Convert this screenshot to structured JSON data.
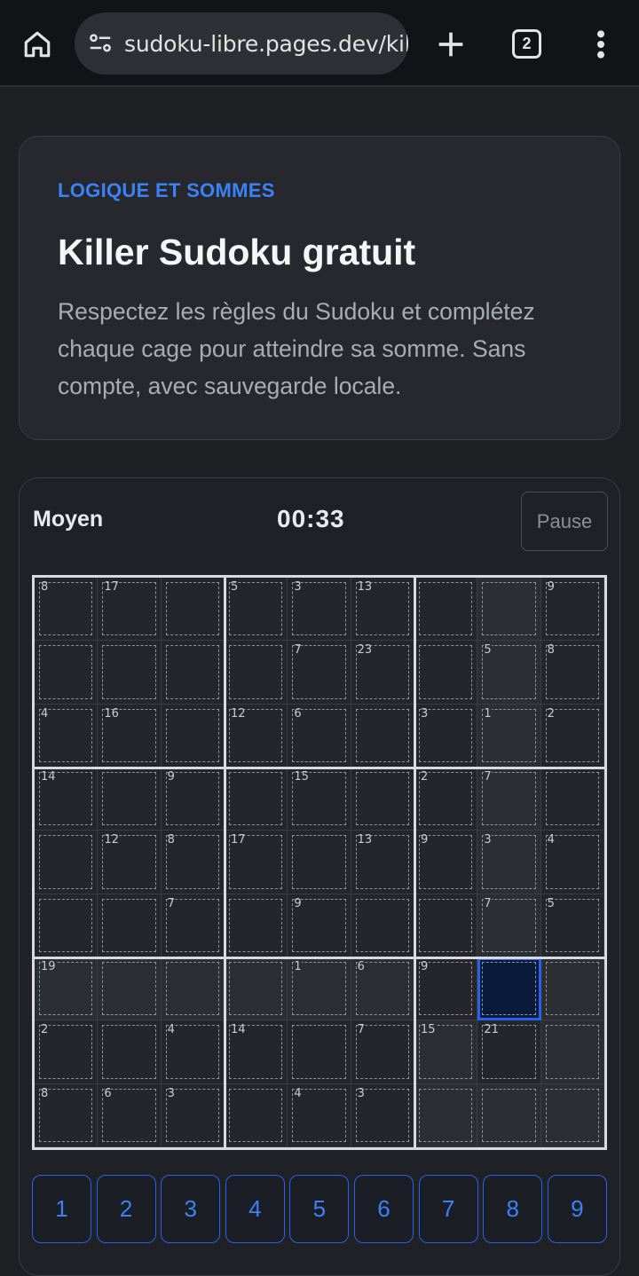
{
  "browser": {
    "url": "sudoku-libre.pages.dev/killer",
    "tab_count": "2"
  },
  "intro": {
    "eyebrow": "LOGIQUE ET SOMMES",
    "title": "Killer Sudoku gratuit",
    "description": "Respectez les règles du Sudoku et complétez chaque cage pour atteindre sa somme. Sans compte, avec sauvegarde locale."
  },
  "game": {
    "difficulty": "Moyen",
    "timer": "00:33",
    "pause_label": "Pause"
  },
  "board": {
    "clues": [
      {
        "r": 0,
        "c": 0,
        "v": "8"
      },
      {
        "r": 0,
        "c": 1,
        "v": "17"
      },
      {
        "r": 0,
        "c": 3,
        "v": "5"
      },
      {
        "r": 0,
        "c": 4,
        "v": "3"
      },
      {
        "r": 0,
        "c": 5,
        "v": "13"
      },
      {
        "r": 0,
        "c": 8,
        "v": "9"
      },
      {
        "r": 1,
        "c": 4,
        "v": "7"
      },
      {
        "r": 1,
        "c": 5,
        "v": "23"
      },
      {
        "r": 1,
        "c": 7,
        "v": "5"
      },
      {
        "r": 1,
        "c": 8,
        "v": "8"
      },
      {
        "r": 2,
        "c": 0,
        "v": "4"
      },
      {
        "r": 2,
        "c": 1,
        "v": "16"
      },
      {
        "r": 2,
        "c": 3,
        "v": "12"
      },
      {
        "r": 2,
        "c": 4,
        "v": "6"
      },
      {
        "r": 2,
        "c": 6,
        "v": "3"
      },
      {
        "r": 2,
        "c": 7,
        "v": "1"
      },
      {
        "r": 2,
        "c": 8,
        "v": "2"
      },
      {
        "r": 3,
        "c": 0,
        "v": "14"
      },
      {
        "r": 3,
        "c": 2,
        "v": "9"
      },
      {
        "r": 3,
        "c": 4,
        "v": "15"
      },
      {
        "r": 3,
        "c": 6,
        "v": "2"
      },
      {
        "r": 3,
        "c": 7,
        "v": "7"
      },
      {
        "r": 4,
        "c": 1,
        "v": "12"
      },
      {
        "r": 4,
        "c": 2,
        "v": "8"
      },
      {
        "r": 4,
        "c": 3,
        "v": "17"
      },
      {
        "r": 4,
        "c": 5,
        "v": "13"
      },
      {
        "r": 4,
        "c": 6,
        "v": "9"
      },
      {
        "r": 4,
        "c": 7,
        "v": "3"
      },
      {
        "r": 4,
        "c": 8,
        "v": "4"
      },
      {
        "r": 5,
        "c": 2,
        "v": "7"
      },
      {
        "r": 5,
        "c": 4,
        "v": "9"
      },
      {
        "r": 5,
        "c": 7,
        "v": "7"
      },
      {
        "r": 5,
        "c": 8,
        "v": "5"
      },
      {
        "r": 6,
        "c": 0,
        "v": "19"
      },
      {
        "r": 6,
        "c": 4,
        "v": "1"
      },
      {
        "r": 6,
        "c": 5,
        "v": "6"
      },
      {
        "r": 6,
        "c": 6,
        "v": "9"
      },
      {
        "r": 7,
        "c": 0,
        "v": "2"
      },
      {
        "r": 7,
        "c": 2,
        "v": "4"
      },
      {
        "r": 7,
        "c": 3,
        "v": "14"
      },
      {
        "r": 7,
        "c": 5,
        "v": "7"
      },
      {
        "r": 7,
        "c": 6,
        "v": "15"
      },
      {
        "r": 7,
        "c": 7,
        "v": "21"
      },
      {
        "r": 8,
        "c": 0,
        "v": "8"
      },
      {
        "r": 8,
        "c": 1,
        "v": "6"
      },
      {
        "r": 8,
        "c": 2,
        "v": "3"
      },
      {
        "r": 8,
        "c": 4,
        "v": "4"
      },
      {
        "r": 8,
        "c": 5,
        "v": "3"
      }
    ],
    "selected": {
      "r": 6,
      "c": 7
    }
  },
  "keypad": [
    "1",
    "2",
    "3",
    "4",
    "5",
    "6",
    "7",
    "8",
    "9"
  ],
  "colors": {
    "accent": "#3b82f6",
    "selected_fill": "#0a1a3a"
  }
}
